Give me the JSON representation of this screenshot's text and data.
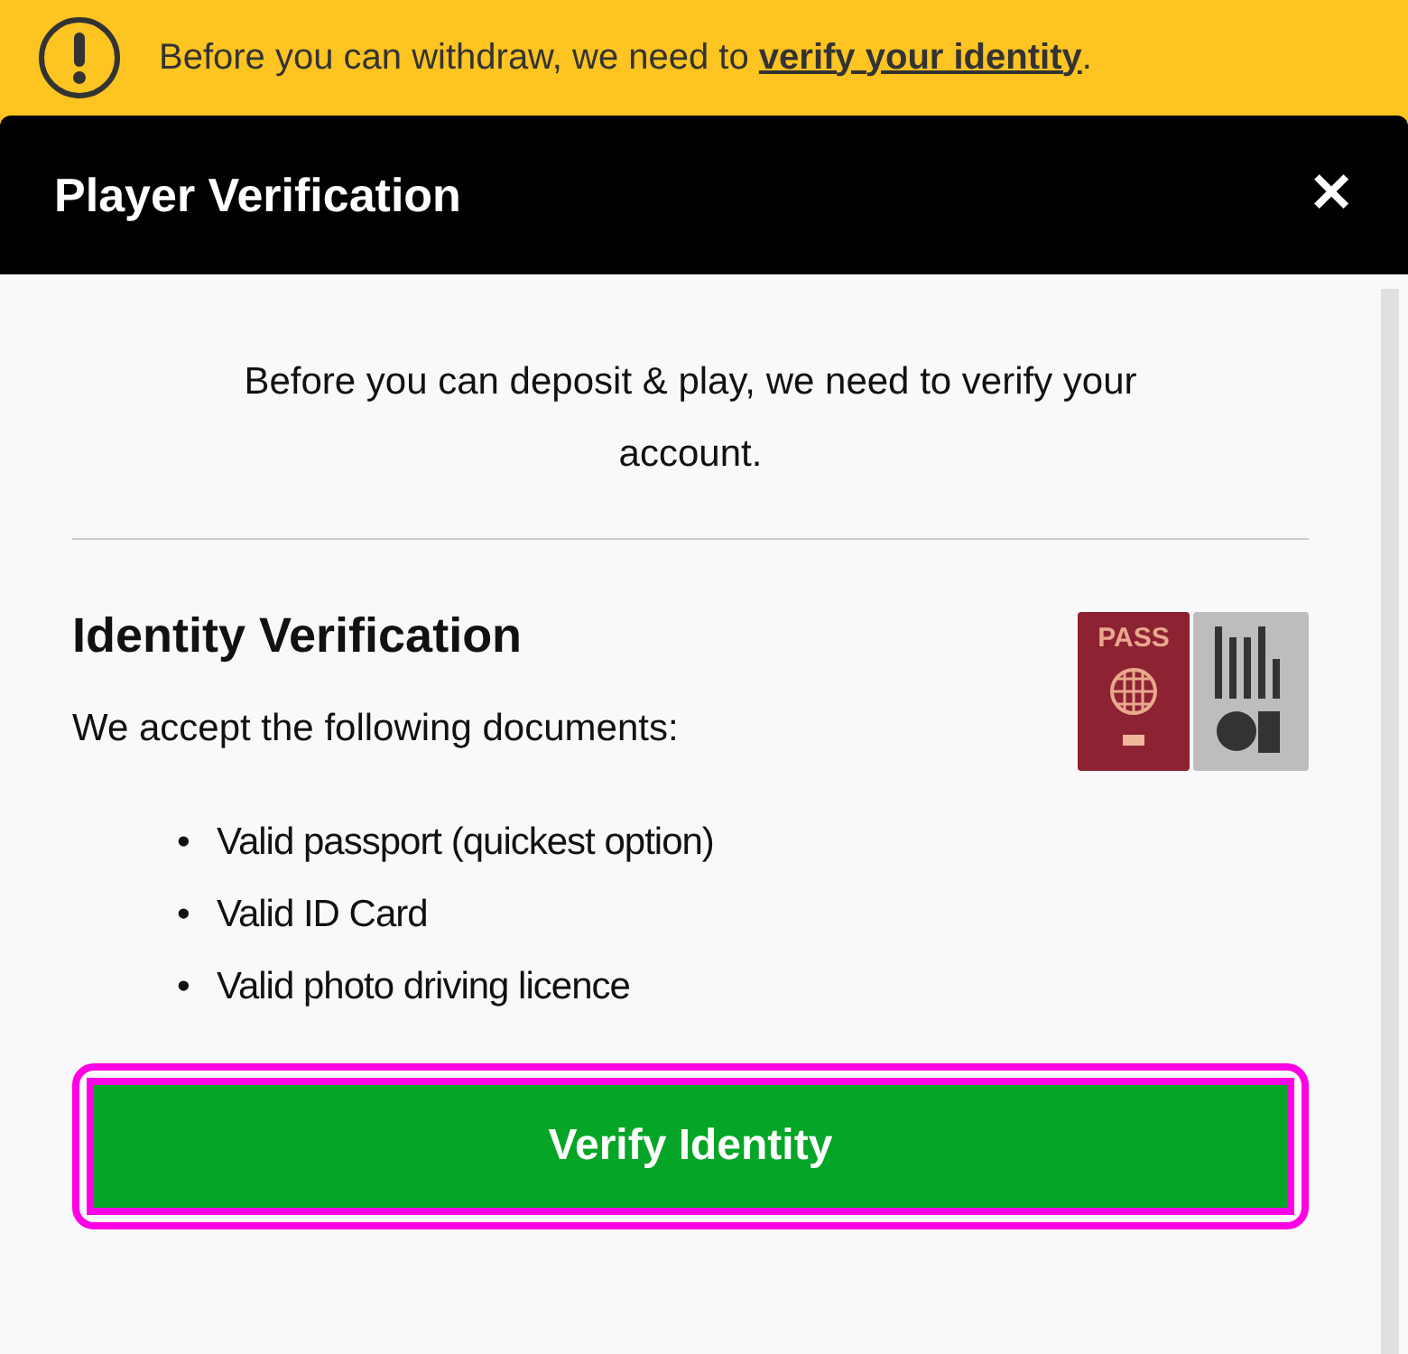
{
  "banner": {
    "text": "Before you can withdraw, we need to **verify your identity**."
  },
  "dialog": {
    "title": "Player Verification",
    "close": "✕"
  },
  "intro": "Before you can deposit & play, we need to verify your account.",
  "section": {
    "heading": "Identity Verification",
    "passport_label": "PASS",
    "lead": "We accept the following documents:",
    "documents": [
      {
        "bullet": "•",
        "text": "Valid passport (quickest option)"
      },
      {
        "bullet": "•",
        "text": "Valid ID Card"
      },
      {
        "bullet": "•",
        "text": "Valid photo driving licence"
      }
    ]
  },
  "button": {
    "label": "Verify Identity",
    "focused": true
  }
}
